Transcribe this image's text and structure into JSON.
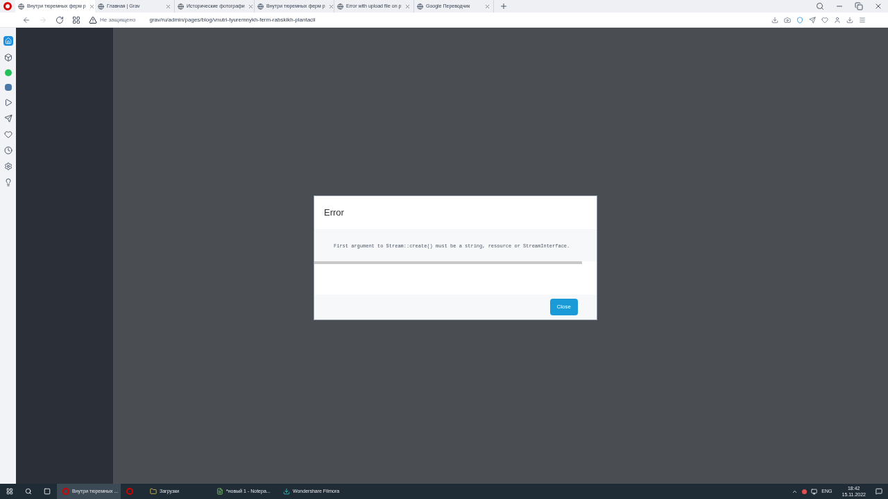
{
  "browser": {
    "tabs": [
      {
        "title": "Внутри тюремных ферм р",
        "selected": true
      },
      {
        "title": "Главная | Grav",
        "selected": false
      },
      {
        "title": "Исторические фотографи",
        "selected": false
      },
      {
        "title": "Внутри тюремных ферм р",
        "selected": false
      },
      {
        "title": "Error with upload file on p",
        "selected": false
      },
      {
        "title": "Google Переводчик",
        "selected": false
      }
    ],
    "security": "Не защищено",
    "url": "grav/ru/admin/pages/blog/vnutri-tyuremnykh-ferm-rabskikh-plantacii"
  },
  "dialog": {
    "title": "Error",
    "message": "First argument to Stream::create() must be a string, resource or StreamInterface.",
    "button": "Close"
  },
  "taskbar": {
    "apps": [
      {
        "label": "Внутри тюремных ...",
        "selected": true
      },
      {
        "selected": false
      },
      {
        "label": "Загрузки",
        "selected": false
      },
      {
        "label": "*новый 1 - Notepa...",
        "selected": false
      },
      {
        "label": "Wondershare Filmora",
        "selected": false
      }
    ],
    "language": "ENG",
    "time": "18:42",
    "date": "15.11.2022"
  }
}
